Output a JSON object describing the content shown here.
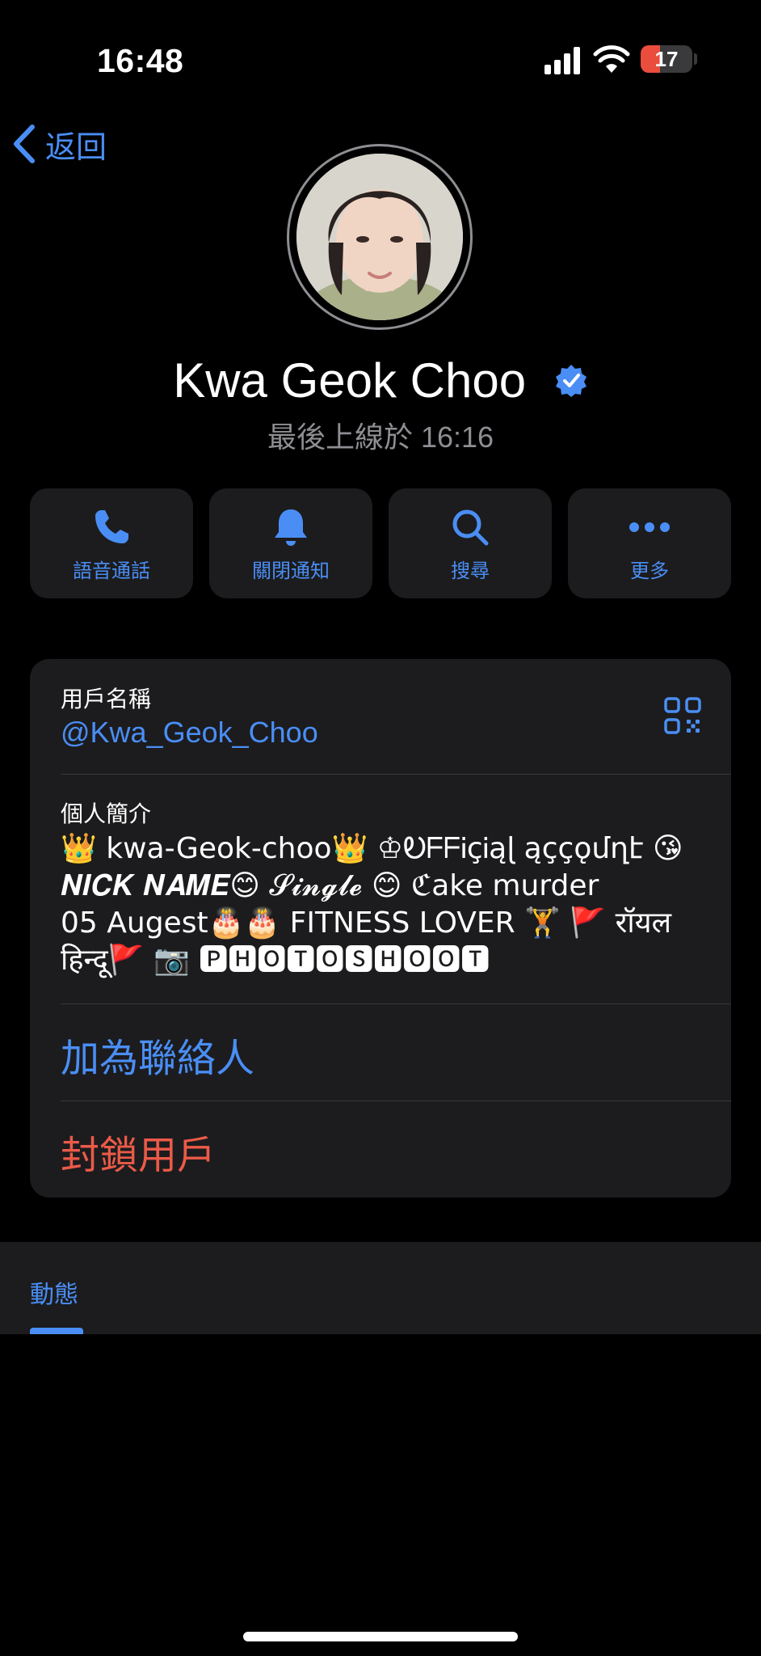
{
  "status_bar": {
    "time": "16:48",
    "battery": "17"
  },
  "nav": {
    "back_label": "返回"
  },
  "profile": {
    "name": "Kwa Geok Choo",
    "last_seen": "最後上線於 16:16"
  },
  "actions": [
    {
      "label": "語音通話",
      "icon": "phone-icon"
    },
    {
      "label": "關閉通知",
      "icon": "bell-icon"
    },
    {
      "label": "搜尋",
      "icon": "search-icon"
    },
    {
      "label": "更多",
      "icon": "more-icon"
    }
  ],
  "info": {
    "username_label": "用戶名稱",
    "username": "@Kwa_Geok_Choo",
    "bio_label": "個人簡介",
    "bio_lines": [
      "👑 kwa-Geok-choo👑 ♔ᎧᖴᖴᎥçᎥąɭ ąççǫմղէ 😘",
      "𝑵𝑰𝑪𝑲 𝑵𝑨𝑴𝑬😊 𝓢𝓲𝓷𝓰𝓵𝓮 😊 ℭake murder",
      "05 Augest🎂🎂 FITNESS LOVER 🏋️ 🚩 रॉयल",
      "हिन्दू🚩 📷 🅿🅷🅾🆃🅾🆂🅷🅾🅾🆃"
    ],
    "add_contact": "加為聯絡人",
    "block_user": "封鎖用戶"
  },
  "stories": {
    "tab_label": "動態"
  },
  "colors": {
    "accent": "#4a8ef5",
    "destructive": "#eb5a48",
    "card": "#1c1c1e",
    "background": "#000000"
  }
}
